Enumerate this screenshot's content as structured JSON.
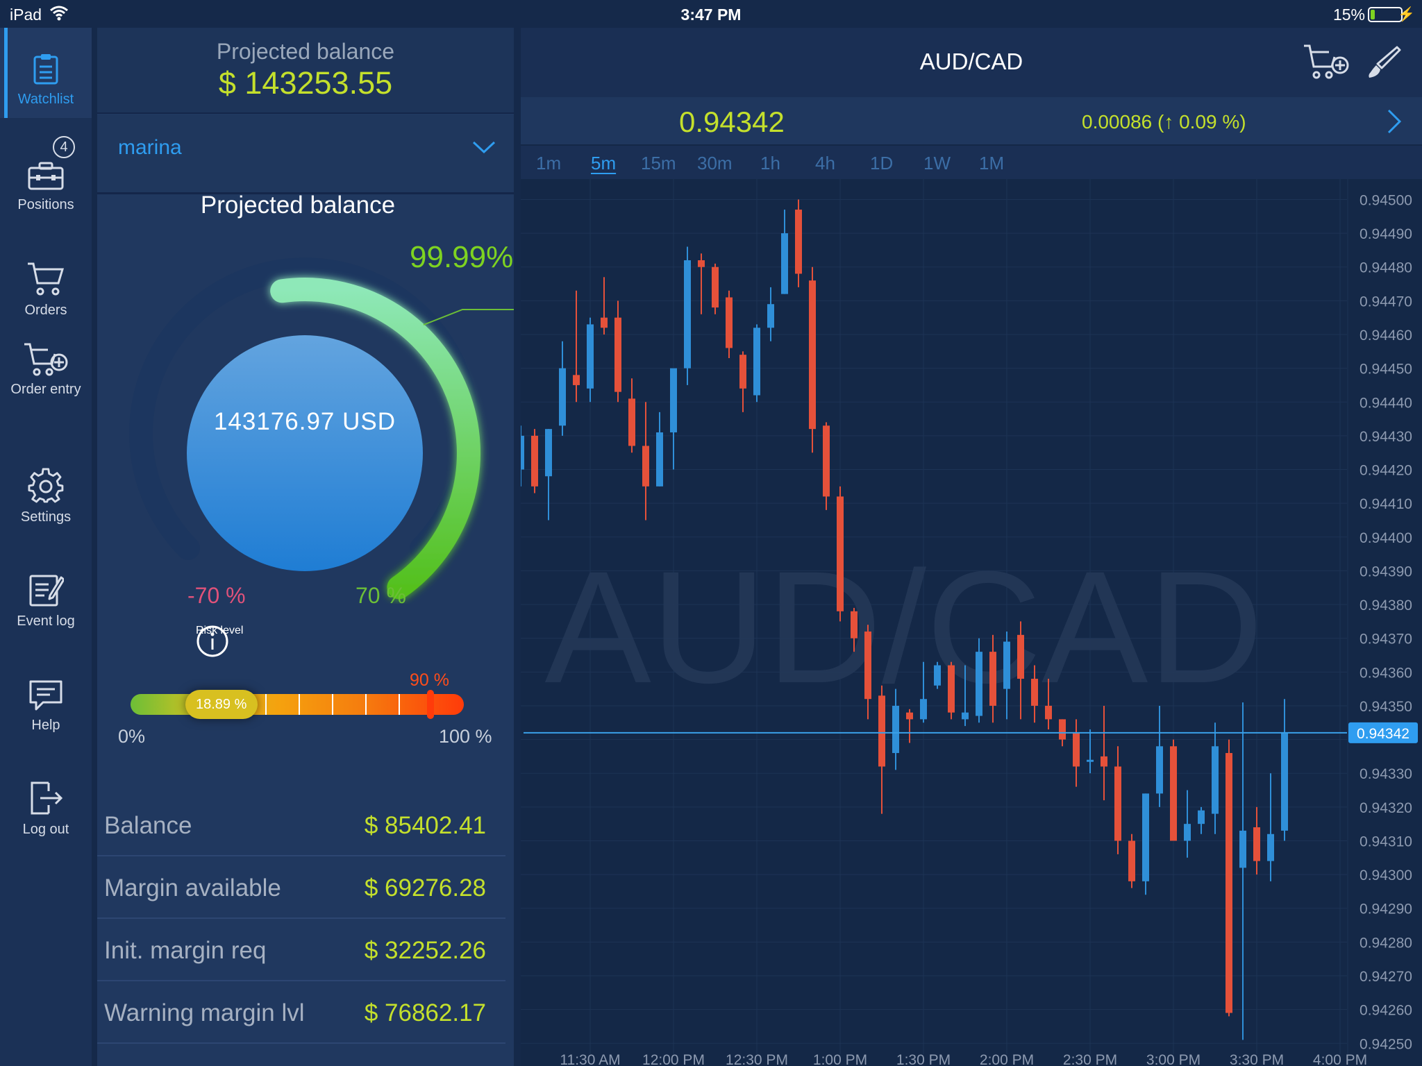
{
  "status": {
    "device": "iPad",
    "time": "3:47 PM",
    "battery": "15%",
    "battery_level": 0.15
  },
  "nav": [
    {
      "label": "Watchlist",
      "icon": "clipboard-icon",
      "active": true
    },
    {
      "label": "Positions",
      "icon": "briefcase-icon",
      "badge": "4"
    },
    {
      "label": "Orders",
      "icon": "cart-icon"
    },
    {
      "label": "Order entry",
      "icon": "cart-plus-icon"
    },
    {
      "label": "Settings",
      "icon": "gear-icon"
    },
    {
      "label": "Event log",
      "icon": "notepad-icon"
    },
    {
      "label": "Help",
      "icon": "speech-bubble-icon"
    },
    {
      "label": "Log out",
      "icon": "logout-icon"
    }
  ],
  "account": {
    "header_label": "Projected balance",
    "header_value": "$ 143253.55",
    "account_name": "marina",
    "gauge_title": "Projected balance",
    "gauge_center": "143176.97 USD",
    "gauge_percent": "99.99%",
    "gauge_fraction": 0.9999,
    "gauge_low": "-70 %",
    "gauge_high": "70 %",
    "risk_label": "Risk level",
    "risk_value": "18.89 %",
    "risk_fraction": 0.1889,
    "risk_threshold": "90 %",
    "risk_min": "0%",
    "risk_max": "100 %",
    "metrics": [
      {
        "label": "Balance",
        "value": "$ 85402.41"
      },
      {
        "label": "Margin available",
        "value": "$ 69276.28"
      },
      {
        "label": "Init. margin req",
        "value": "$ 32252.26"
      },
      {
        "label": "Warning margin lvl",
        "value": "$ 76862.17"
      }
    ]
  },
  "chart_header": {
    "symbol": "AUD/CAD",
    "price": "0.94342",
    "change": "0.00086 (↑ 0.09 %)",
    "timeframes": [
      "1m",
      "5m",
      "15m",
      "30m",
      "1h",
      "4h",
      "1D",
      "1W",
      "1M"
    ],
    "active_timeframe": "5m"
  },
  "colors": {
    "up": "#2f8fd8",
    "down": "#e5513a",
    "accent": "#2f9df0",
    "lime": "#c4e02c",
    "green": "#7ed321"
  },
  "chart_data": {
    "type": "candlestick",
    "watermark": "AUD/CAD",
    "x_ticks": [
      "11:30 AM",
      "12:00 PM",
      "12:30 PM",
      "1:00 PM",
      "1:30 PM",
      "2:00 PM",
      "2:30 PM",
      "3:00 PM",
      "3:30 PM",
      "4:00 PM"
    ],
    "y_ticks": [
      "0.94500",
      "0.94490",
      "0.94480",
      "0.94470",
      "0.94460",
      "0.94450",
      "0.94440",
      "0.94430",
      "0.94420",
      "0.94410",
      "0.94400",
      "0.94390",
      "0.94380",
      "0.94370",
      "0.94360",
      "0.94350",
      "0.94340",
      "0.94330",
      "0.94320",
      "0.94310",
      "0.94300",
      "0.94290",
      "0.94280",
      "0.94270",
      "0.94260",
      "0.94250"
    ],
    "ylim": [
      0.94248,
      0.94504
    ],
    "current_price": 0.94342,
    "current_price_label": "0.94342",
    "candles": [
      {
        "t": "11:05",
        "o": 0.9442,
        "h": 0.94433,
        "l": 0.94415,
        "c": 0.9443
      },
      {
        "t": "11:10",
        "o": 0.9443,
        "h": 0.94432,
        "l": 0.94413,
        "c": 0.94415
      },
      {
        "t": "11:15",
        "o": 0.94418,
        "h": 0.94432,
        "l": 0.94405,
        "c": 0.94432
      },
      {
        "t": "11:20",
        "o": 0.94433,
        "h": 0.94458,
        "l": 0.9443,
        "c": 0.9445
      },
      {
        "t": "11:25",
        "o": 0.94448,
        "h": 0.94473,
        "l": 0.9444,
        "c": 0.94445
      },
      {
        "t": "11:30",
        "o": 0.94444,
        "h": 0.94465,
        "l": 0.9444,
        "c": 0.94463
      },
      {
        "t": "11:35",
        "o": 0.94465,
        "h": 0.94477,
        "l": 0.9446,
        "c": 0.94462
      },
      {
        "t": "11:40",
        "o": 0.94465,
        "h": 0.9447,
        "l": 0.9444,
        "c": 0.94443
      },
      {
        "t": "11:45",
        "o": 0.94441,
        "h": 0.94447,
        "l": 0.94425,
        "c": 0.94427
      },
      {
        "t": "11:50",
        "o": 0.94427,
        "h": 0.9444,
        "l": 0.94405,
        "c": 0.94415
      },
      {
        "t": "11:55",
        "o": 0.94415,
        "h": 0.94437,
        "l": 0.94415,
        "c": 0.94431
      },
      {
        "t": "12:00",
        "o": 0.94431,
        "h": 0.9444,
        "l": 0.9442,
        "c": 0.9445
      },
      {
        "t": "12:05",
        "o": 0.9445,
        "h": 0.94486,
        "l": 0.94445,
        "c": 0.94482
      },
      {
        "t": "12:10",
        "o": 0.94482,
        "h": 0.94484,
        "l": 0.94466,
        "c": 0.9448
      },
      {
        "t": "12:15",
        "o": 0.9448,
        "h": 0.94481,
        "l": 0.94466,
        "c": 0.94468
      },
      {
        "t": "12:20",
        "o": 0.94471,
        "h": 0.94473,
        "l": 0.94453,
        "c": 0.94456
      },
      {
        "t": "12:25",
        "o": 0.94454,
        "h": 0.94455,
        "l": 0.94437,
        "c": 0.94444
      },
      {
        "t": "12:30",
        "o": 0.94442,
        "h": 0.94463,
        "l": 0.9444,
        "c": 0.94462
      },
      {
        "t": "12:35",
        "o": 0.94462,
        "h": 0.94474,
        "l": 0.94458,
        "c": 0.94469
      },
      {
        "t": "12:40",
        "o": 0.94472,
        "h": 0.94497,
        "l": 0.94472,
        "c": 0.9449
      },
      {
        "t": "12:45",
        "o": 0.94497,
        "h": 0.945,
        "l": 0.94474,
        "c": 0.94478
      },
      {
        "t": "12:50",
        "o": 0.94476,
        "h": 0.9448,
        "l": 0.94425,
        "c": 0.94432
      },
      {
        "t": "12:55",
        "o": 0.94433,
        "h": 0.94434,
        "l": 0.94408,
        "c": 0.94412
      },
      {
        "t": "13:00",
        "o": 0.94412,
        "h": 0.94415,
        "l": 0.94375,
        "c": 0.94378
      },
      {
        "t": "13:05",
        "o": 0.94378,
        "h": 0.94379,
        "l": 0.94366,
        "c": 0.9437
      },
      {
        "t": "13:10",
        "o": 0.94372,
        "h": 0.94374,
        "l": 0.94346,
        "c": 0.94352
      },
      {
        "t": "13:15",
        "o": 0.94353,
        "h": 0.94356,
        "l": 0.94318,
        "c": 0.94332
      },
      {
        "t": "13:20",
        "o": 0.94336,
        "h": 0.94355,
        "l": 0.94331,
        "c": 0.9435
      },
      {
        "t": "13:25",
        "o": 0.94348,
        "h": 0.94349,
        "l": 0.94339,
        "c": 0.94346
      },
      {
        "t": "13:30",
        "o": 0.94346,
        "h": 0.94363,
        "l": 0.94345,
        "c": 0.94352
      },
      {
        "t": "13:35",
        "o": 0.94356,
        "h": 0.94363,
        "l": 0.94355,
        "c": 0.94362
      },
      {
        "t": "13:40",
        "o": 0.94362,
        "h": 0.94363,
        "l": 0.94346,
        "c": 0.94348
      },
      {
        "t": "13:45",
        "o": 0.94346,
        "h": 0.94362,
        "l": 0.94344,
        "c": 0.94348
      },
      {
        "t": "13:50",
        "o": 0.94347,
        "h": 0.9437,
        "l": 0.94345,
        "c": 0.94366
      },
      {
        "t": "13:55",
        "o": 0.94366,
        "h": 0.94371,
        "l": 0.94345,
        "c": 0.9435
      },
      {
        "t": "14:00",
        "o": 0.94355,
        "h": 0.94372,
        "l": 0.94346,
        "c": 0.94369
      },
      {
        "t": "14:05",
        "o": 0.94371,
        "h": 0.94375,
        "l": 0.94346,
        "c": 0.94358
      },
      {
        "t": "14:10",
        "o": 0.94358,
        "h": 0.94362,
        "l": 0.94345,
        "c": 0.9435
      },
      {
        "t": "14:15",
        "o": 0.9435,
        "h": 0.94358,
        "l": 0.94343,
        "c": 0.94346
      },
      {
        "t": "14:20",
        "o": 0.94346,
        "h": 0.94346,
        "l": 0.94338,
        "c": 0.9434
      },
      {
        "t": "14:25",
        "o": 0.94342,
        "h": 0.94346,
        "l": 0.94326,
        "c": 0.94332
      },
      {
        "t": "14:30",
        "o": 0.94334,
        "h": 0.94343,
        "l": 0.9433,
        "c": 0.94334
      },
      {
        "t": "14:35",
        "o": 0.94335,
        "h": 0.9435,
        "l": 0.94322,
        "c": 0.94332
      },
      {
        "t": "14:40",
        "o": 0.94332,
        "h": 0.94338,
        "l": 0.94306,
        "c": 0.9431
      },
      {
        "t": "14:45",
        "o": 0.9431,
        "h": 0.94312,
        "l": 0.94296,
        "c": 0.94298
      },
      {
        "t": "14:50",
        "o": 0.94298,
        "h": 0.94324,
        "l": 0.94294,
        "c": 0.94324
      },
      {
        "t": "14:55",
        "o": 0.94324,
        "h": 0.9435,
        "l": 0.9432,
        "c": 0.94338
      },
      {
        "t": "15:00",
        "o": 0.94338,
        "h": 0.9434,
        "l": 0.9431,
        "c": 0.9431
      },
      {
        "t": "15:05",
        "o": 0.9431,
        "h": 0.94325,
        "l": 0.94305,
        "c": 0.94315
      },
      {
        "t": "15:10",
        "o": 0.94315,
        "h": 0.9432,
        "l": 0.94312,
        "c": 0.94319
      },
      {
        "t": "15:15",
        "o": 0.94318,
        "h": 0.94345,
        "l": 0.94312,
        "c": 0.94338
      },
      {
        "t": "15:20",
        "o": 0.94336,
        "h": 0.9434,
        "l": 0.94258,
        "c": 0.94259
      },
      {
        "t": "15:25",
        "o": 0.94302,
        "h": 0.94351,
        "l": 0.94251,
        "c": 0.94313
      },
      {
        "t": "15:30",
        "o": 0.94314,
        "h": 0.9432,
        "l": 0.943,
        "c": 0.94304
      },
      {
        "t": "15:35",
        "o": 0.94304,
        "h": 0.9433,
        "l": 0.94298,
        "c": 0.94312
      },
      {
        "t": "15:40",
        "o": 0.94313,
        "h": 0.94352,
        "l": 0.9431,
        "c": 0.94342
      }
    ]
  }
}
